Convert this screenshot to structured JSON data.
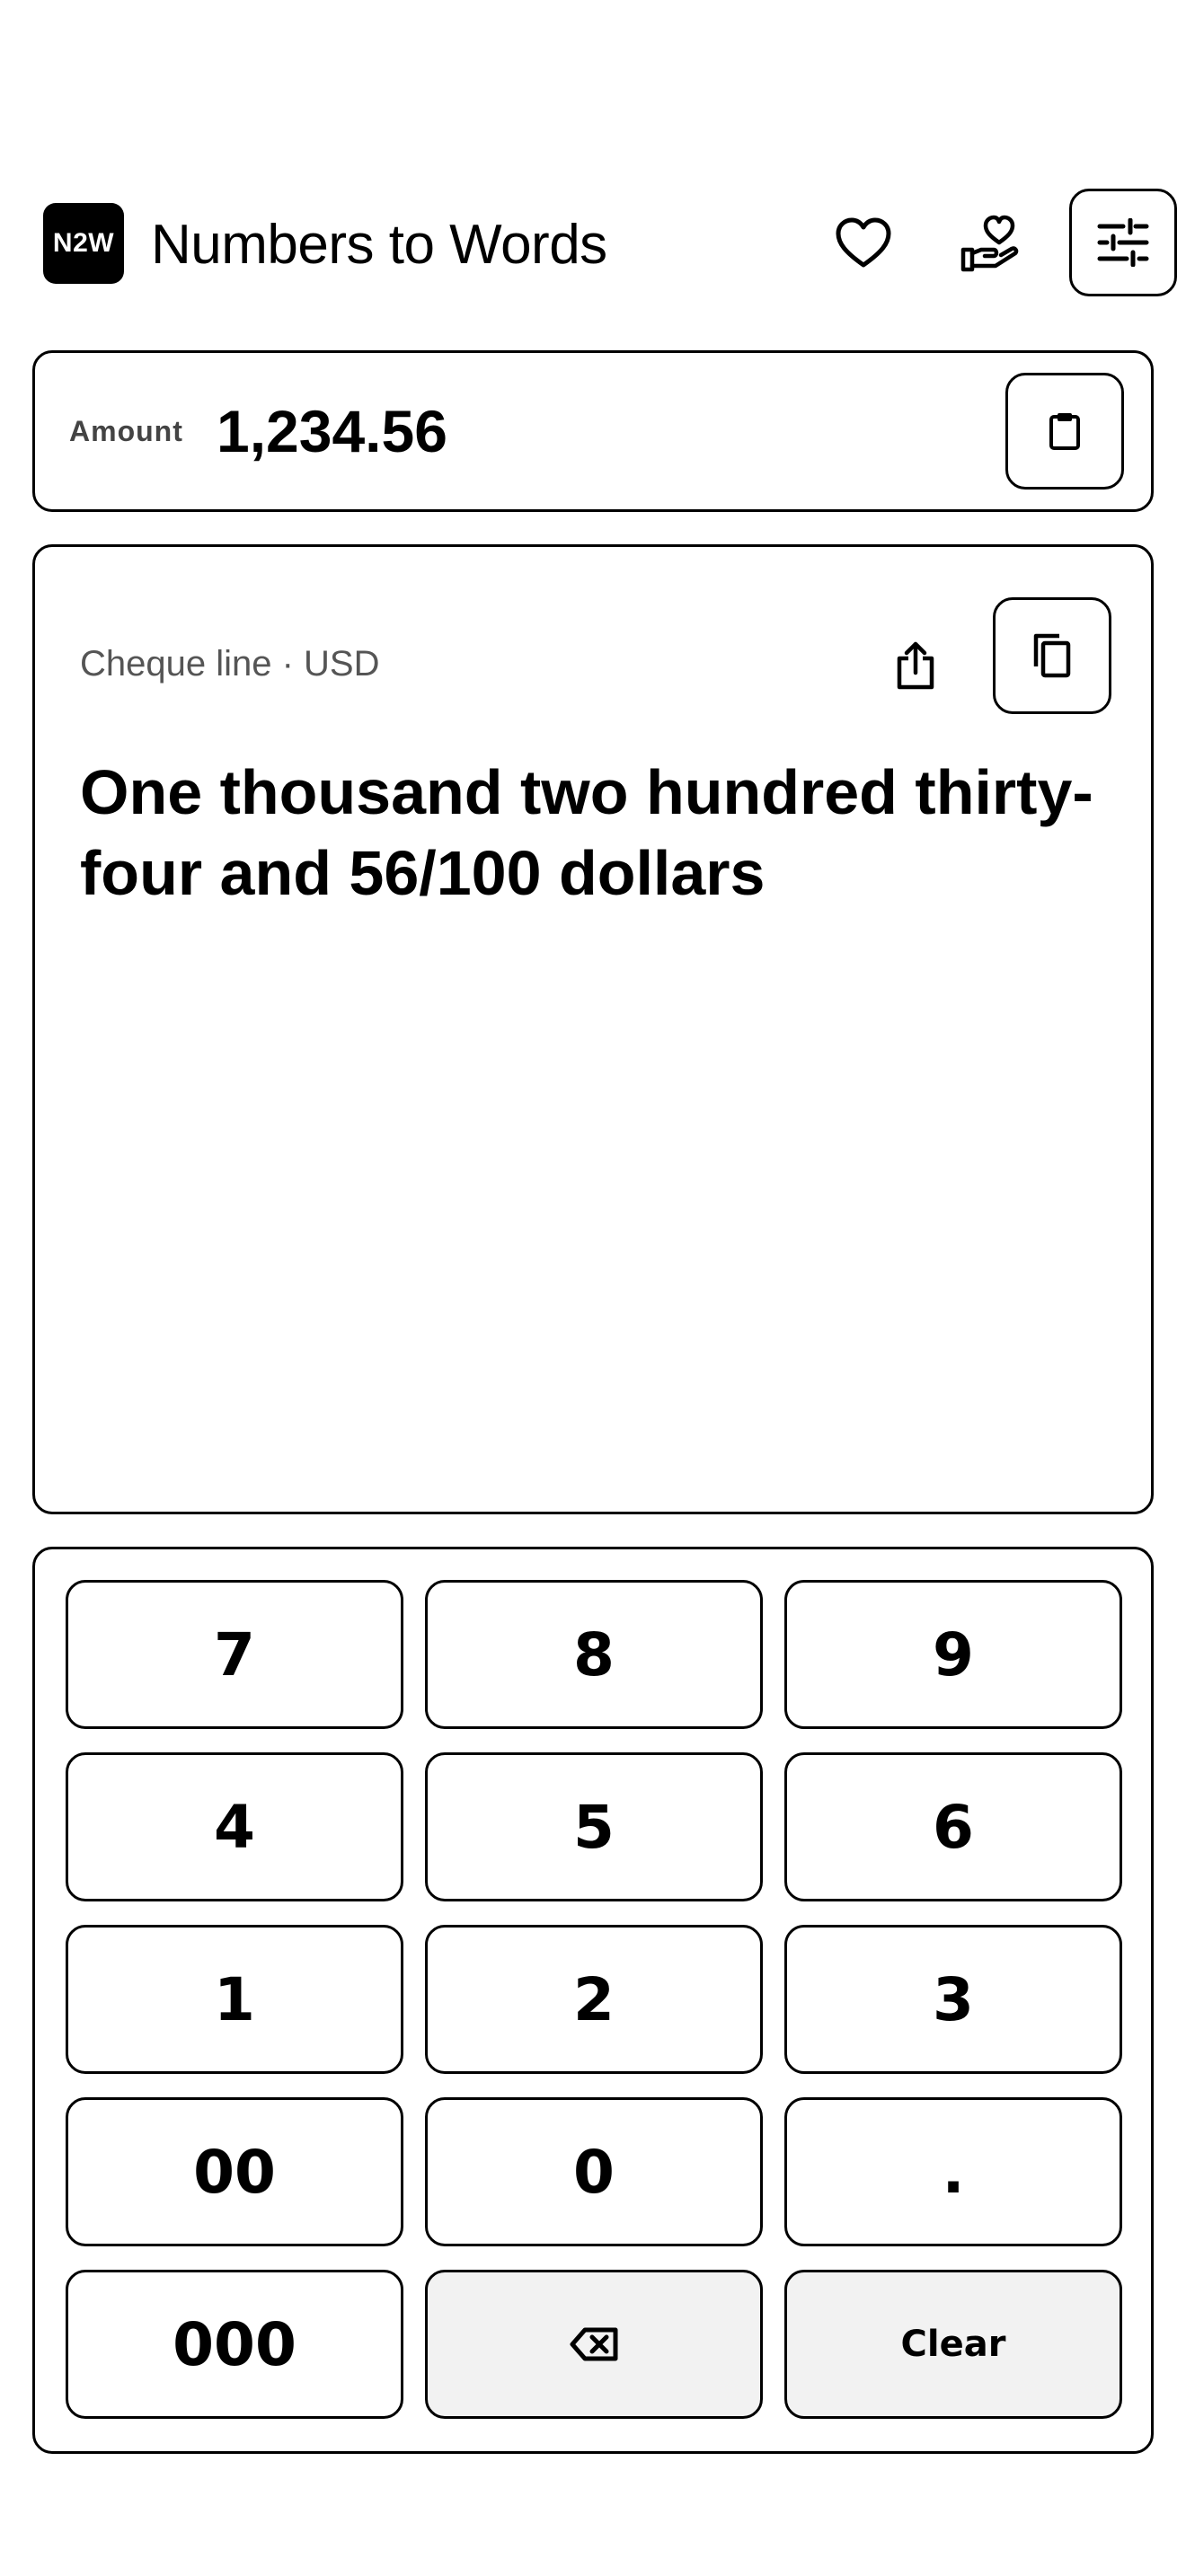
{
  "header": {
    "logo_text": "N2W",
    "title": "Numbers to Words",
    "icons": [
      "heart-icon",
      "donate-heart-hand-icon",
      "settings-sliders-icon"
    ]
  },
  "amount": {
    "label": "Amount",
    "value": "1,234.56",
    "paste_icon": "clipboard-icon"
  },
  "result": {
    "label": "Cheque line · USD",
    "text": "One thousand two hundred thirty-four and 56/100 dollars",
    "share_icon": "share-icon",
    "copy_icon": "copy-icon"
  },
  "keypad": {
    "keys": [
      "7",
      "8",
      "9",
      "4",
      "5",
      "6",
      "1",
      "2",
      "3",
      "00",
      "0",
      ".",
      "000"
    ],
    "backspace_icon": "backspace-icon",
    "clear_label": "Clear"
  },
  "colors": {
    "foreground": "#000000",
    "background": "#ffffff",
    "muted_key": "#f2f2f2"
  }
}
